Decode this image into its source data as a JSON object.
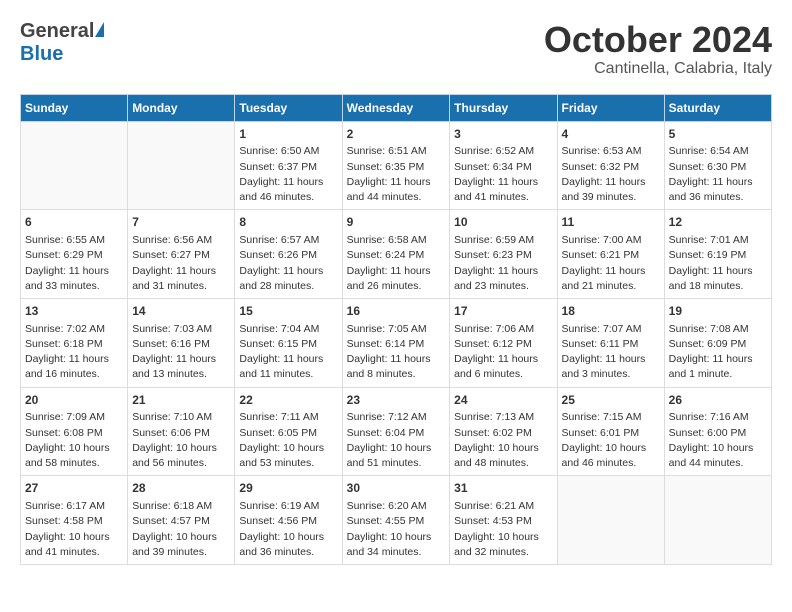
{
  "logo": {
    "general": "General",
    "blue": "Blue"
  },
  "title": "October 2024",
  "location": "Cantinella, Calabria, Italy",
  "days_of_week": [
    "Sunday",
    "Monday",
    "Tuesday",
    "Wednesday",
    "Thursday",
    "Friday",
    "Saturday"
  ],
  "weeks": [
    [
      {
        "day": "",
        "info": ""
      },
      {
        "day": "",
        "info": ""
      },
      {
        "day": "1",
        "info": "Sunrise: 6:50 AM\nSunset: 6:37 PM\nDaylight: 11 hours and 46 minutes."
      },
      {
        "day": "2",
        "info": "Sunrise: 6:51 AM\nSunset: 6:35 PM\nDaylight: 11 hours and 44 minutes."
      },
      {
        "day": "3",
        "info": "Sunrise: 6:52 AM\nSunset: 6:34 PM\nDaylight: 11 hours and 41 minutes."
      },
      {
        "day": "4",
        "info": "Sunrise: 6:53 AM\nSunset: 6:32 PM\nDaylight: 11 hours and 39 minutes."
      },
      {
        "day": "5",
        "info": "Sunrise: 6:54 AM\nSunset: 6:30 PM\nDaylight: 11 hours and 36 minutes."
      }
    ],
    [
      {
        "day": "6",
        "info": "Sunrise: 6:55 AM\nSunset: 6:29 PM\nDaylight: 11 hours and 33 minutes."
      },
      {
        "day": "7",
        "info": "Sunrise: 6:56 AM\nSunset: 6:27 PM\nDaylight: 11 hours and 31 minutes."
      },
      {
        "day": "8",
        "info": "Sunrise: 6:57 AM\nSunset: 6:26 PM\nDaylight: 11 hours and 28 minutes."
      },
      {
        "day": "9",
        "info": "Sunrise: 6:58 AM\nSunset: 6:24 PM\nDaylight: 11 hours and 26 minutes."
      },
      {
        "day": "10",
        "info": "Sunrise: 6:59 AM\nSunset: 6:23 PM\nDaylight: 11 hours and 23 minutes."
      },
      {
        "day": "11",
        "info": "Sunrise: 7:00 AM\nSunset: 6:21 PM\nDaylight: 11 hours and 21 minutes."
      },
      {
        "day": "12",
        "info": "Sunrise: 7:01 AM\nSunset: 6:19 PM\nDaylight: 11 hours and 18 minutes."
      }
    ],
    [
      {
        "day": "13",
        "info": "Sunrise: 7:02 AM\nSunset: 6:18 PM\nDaylight: 11 hours and 16 minutes."
      },
      {
        "day": "14",
        "info": "Sunrise: 7:03 AM\nSunset: 6:16 PM\nDaylight: 11 hours and 13 minutes."
      },
      {
        "day": "15",
        "info": "Sunrise: 7:04 AM\nSunset: 6:15 PM\nDaylight: 11 hours and 11 minutes."
      },
      {
        "day": "16",
        "info": "Sunrise: 7:05 AM\nSunset: 6:14 PM\nDaylight: 11 hours and 8 minutes."
      },
      {
        "day": "17",
        "info": "Sunrise: 7:06 AM\nSunset: 6:12 PM\nDaylight: 11 hours and 6 minutes."
      },
      {
        "day": "18",
        "info": "Sunrise: 7:07 AM\nSunset: 6:11 PM\nDaylight: 11 hours and 3 minutes."
      },
      {
        "day": "19",
        "info": "Sunrise: 7:08 AM\nSunset: 6:09 PM\nDaylight: 11 hours and 1 minute."
      }
    ],
    [
      {
        "day": "20",
        "info": "Sunrise: 7:09 AM\nSunset: 6:08 PM\nDaylight: 10 hours and 58 minutes."
      },
      {
        "day": "21",
        "info": "Sunrise: 7:10 AM\nSunset: 6:06 PM\nDaylight: 10 hours and 56 minutes."
      },
      {
        "day": "22",
        "info": "Sunrise: 7:11 AM\nSunset: 6:05 PM\nDaylight: 10 hours and 53 minutes."
      },
      {
        "day": "23",
        "info": "Sunrise: 7:12 AM\nSunset: 6:04 PM\nDaylight: 10 hours and 51 minutes."
      },
      {
        "day": "24",
        "info": "Sunrise: 7:13 AM\nSunset: 6:02 PM\nDaylight: 10 hours and 48 minutes."
      },
      {
        "day": "25",
        "info": "Sunrise: 7:15 AM\nSunset: 6:01 PM\nDaylight: 10 hours and 46 minutes."
      },
      {
        "day": "26",
        "info": "Sunrise: 7:16 AM\nSunset: 6:00 PM\nDaylight: 10 hours and 44 minutes."
      }
    ],
    [
      {
        "day": "27",
        "info": "Sunrise: 6:17 AM\nSunset: 4:58 PM\nDaylight: 10 hours and 41 minutes."
      },
      {
        "day": "28",
        "info": "Sunrise: 6:18 AM\nSunset: 4:57 PM\nDaylight: 10 hours and 39 minutes."
      },
      {
        "day": "29",
        "info": "Sunrise: 6:19 AM\nSunset: 4:56 PM\nDaylight: 10 hours and 36 minutes."
      },
      {
        "day": "30",
        "info": "Sunrise: 6:20 AM\nSunset: 4:55 PM\nDaylight: 10 hours and 34 minutes."
      },
      {
        "day": "31",
        "info": "Sunrise: 6:21 AM\nSunset: 4:53 PM\nDaylight: 10 hours and 32 minutes."
      },
      {
        "day": "",
        "info": ""
      },
      {
        "day": "",
        "info": ""
      }
    ]
  ]
}
